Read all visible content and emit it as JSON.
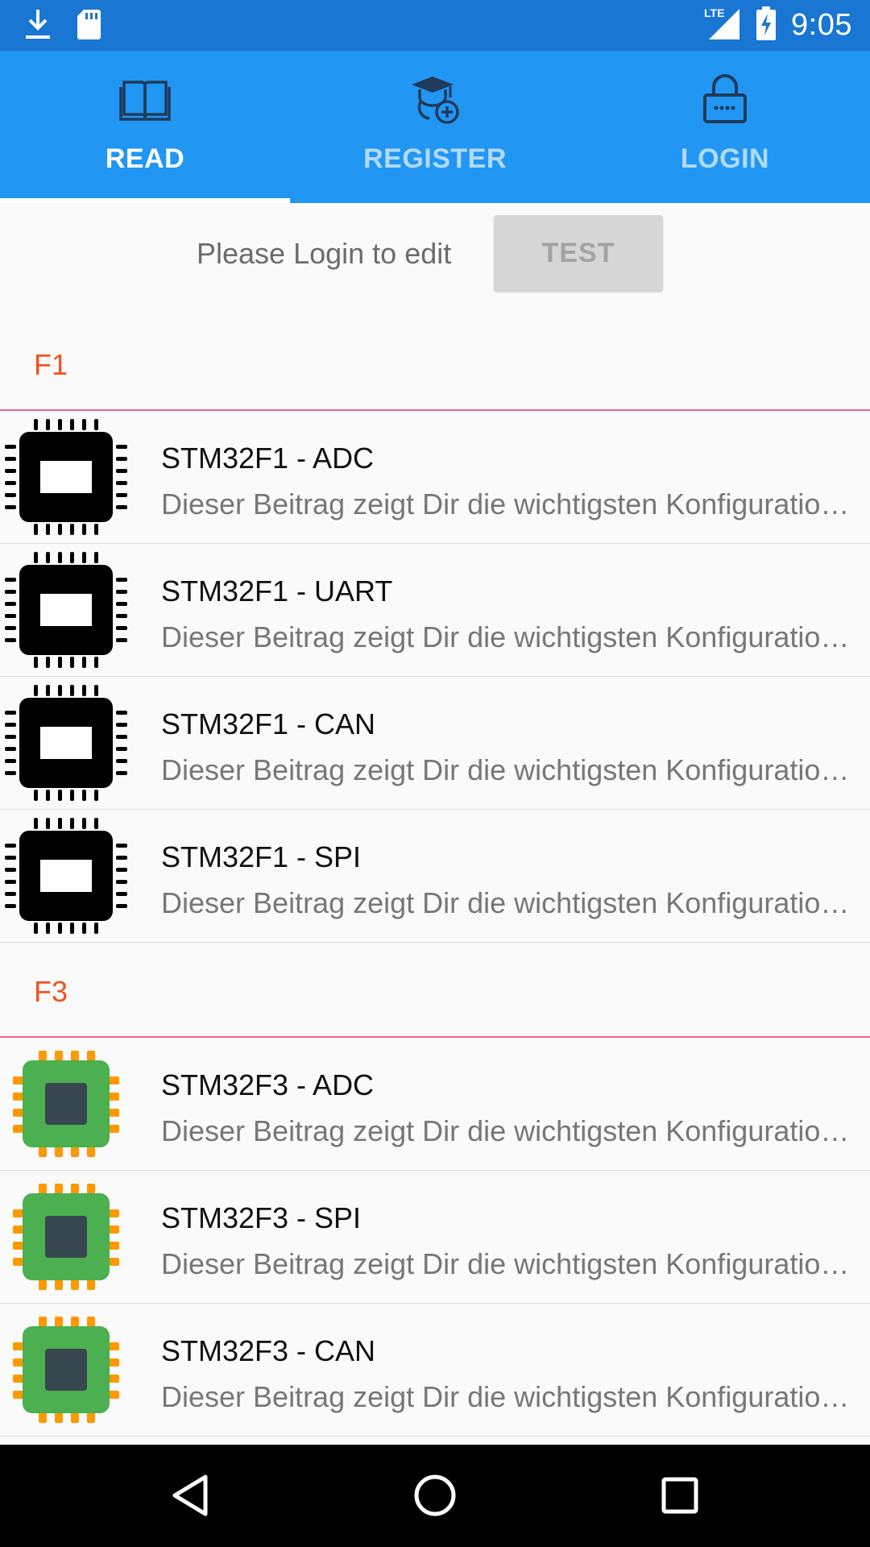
{
  "status_bar": {
    "time": "9:05",
    "network": "LTE",
    "icons": [
      "download-icon",
      "sd-card-icon",
      "lte-signal-icon",
      "battery-charging-icon"
    ]
  },
  "tabs": [
    {
      "label": "READ",
      "icon": "book-icon",
      "active": true
    },
    {
      "label": "REGISTER",
      "icon": "graduate-add-icon",
      "active": false
    },
    {
      "label": "LOGIN",
      "icon": "lock-icon",
      "active": false
    }
  ],
  "login_prompt": {
    "text": "Please Login to edit",
    "button_label": "TEST"
  },
  "sections": [
    {
      "title": "F1",
      "icon": "black-chip-icon",
      "items": [
        {
          "title": "STM32F1 - ADC",
          "subtitle": "Dieser Beitrag zeigt Dir die wichtigsten Konfigurationen"
        },
        {
          "title": "STM32F1 - UART",
          "subtitle": "Dieser Beitrag zeigt Dir die wichtigsten Konfigurationen"
        },
        {
          "title": "STM32F1 - CAN",
          "subtitle": "Dieser Beitrag zeigt Dir die wichtigsten Konfigurationen"
        },
        {
          "title": "STM32F1 - SPI",
          "subtitle": "Dieser Beitrag zeigt Dir die wichtigsten Konfigurationen"
        }
      ]
    },
    {
      "title": "F3",
      "icon": "green-chip-icon",
      "items": [
        {
          "title": "STM32F3 - ADC",
          "subtitle": "Dieser Beitrag zeigt Dir die wichtigsten Konfigurationen"
        },
        {
          "title": "STM32F3 - SPI",
          "subtitle": "Dieser Beitrag zeigt Dir die wichtigsten Konfigurationen"
        },
        {
          "title": "STM32F3 - CAN",
          "subtitle": "Dieser Beitrag zeigt Dir die wichtigsten Konfigurationen"
        }
      ]
    }
  ],
  "nav_bar": [
    "back-icon",
    "home-icon",
    "recents-icon"
  ],
  "colors": {
    "status_bar": "#1976D2",
    "tab_bar": "#2196F3",
    "section_title": "#F4511E",
    "section_divider": "#F06292",
    "green_chip": "#4CAF50",
    "chip_pins": "#FF9800"
  }
}
